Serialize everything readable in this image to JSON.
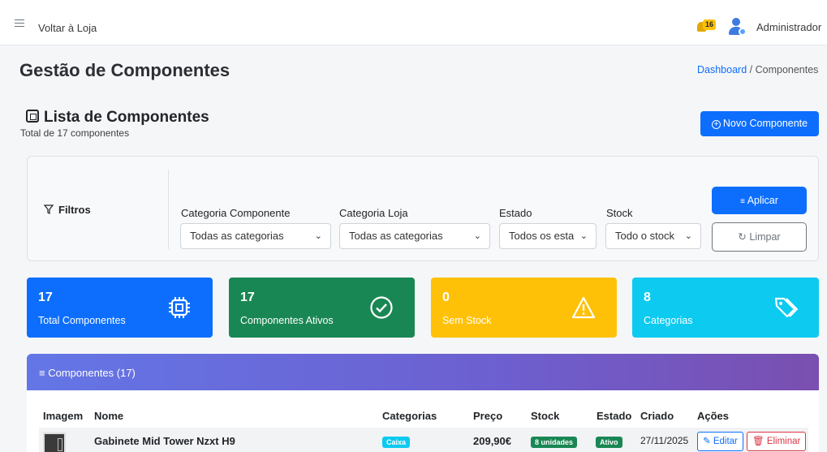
{
  "topbar": {
    "back_label": "Voltar à Loja",
    "notification_count": "16",
    "admin_name": "Administrador"
  },
  "page": {
    "title": "Gestão de Componentes",
    "breadcrumb": {
      "home": "Dashboard",
      "separator": "/",
      "current": "Componentes"
    }
  },
  "list": {
    "title": "Lista de Componentes",
    "subtitle": "Total de 17 componentes",
    "new_button": "Novo Componente"
  },
  "filters": {
    "title": "Filtros",
    "fields": [
      {
        "label": "Categoria Componente",
        "value": "Todas as categorias"
      },
      {
        "label": "Categoria Loja",
        "value": "Todas as categorias"
      },
      {
        "label": "Estado",
        "value": "Todos os esta"
      },
      {
        "label": "Stock",
        "value": "Todo o stock"
      }
    ],
    "apply_label": "Aplicar",
    "clear_label": "Limpar"
  },
  "stats": [
    {
      "value": "17",
      "label": "Total Componentes",
      "color": "#0d6efd",
      "icon": "cpu-icon"
    },
    {
      "value": "17",
      "label": "Componentes Ativos",
      "color": "#198754",
      "icon": "check-circle-icon"
    },
    {
      "value": "0",
      "label": "Sem Stock",
      "color": "#ffc107",
      "icon": "warning-icon"
    },
    {
      "value": "8",
      "label": "Categorias",
      "color": "#0dcaf0",
      "icon": "tags-icon"
    }
  ],
  "table": {
    "title": "Componentes (17)",
    "columns": [
      "Imagem",
      "Nome",
      "Categorias",
      "Preço",
      "Stock",
      "Estado",
      "Criado",
      "Ações"
    ],
    "rows": [
      {
        "name": "Gabinete Mid Tower Nzxt H9",
        "category": "Caixa",
        "price": "209,90€",
        "stock": "8 unidades",
        "status": "Ativo",
        "created": "27/11/2025",
        "edit_label": "Editar",
        "delete_label": "Eliminar"
      }
    ]
  }
}
